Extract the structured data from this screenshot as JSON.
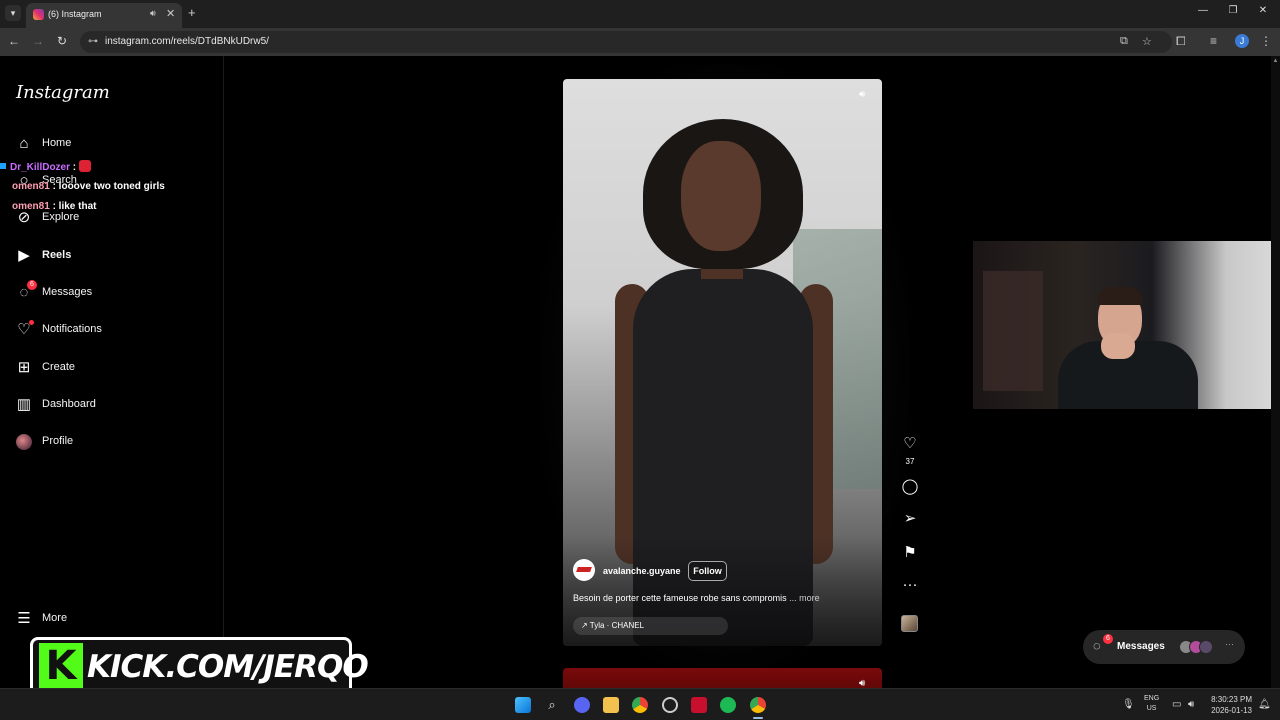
{
  "browser": {
    "tab_title": "(6) Instagram",
    "url": "instagram.com/reels/DTdBNkUDrw5/",
    "icons": {
      "tab_list": "chevron-down-icon",
      "audio": "speaker-icon",
      "close": "close-icon",
      "new_tab": "plus-icon"
    },
    "window_controls": {
      "minimize": "—",
      "restore": "❐",
      "close": "✕"
    }
  },
  "sidebar": {
    "logo": "Instagram",
    "items": [
      {
        "label": "Home",
        "icon": "home-icon"
      },
      {
        "label": "Search",
        "icon": "search-icon"
      },
      {
        "label": "Explore",
        "icon": "compass-icon"
      },
      {
        "label": "Reels",
        "icon": "reels-icon"
      },
      {
        "label": "Messages",
        "icon": "messenger-icon",
        "badge": "6"
      },
      {
        "label": "Notifications",
        "icon": "heart-icon"
      },
      {
        "label": "Create",
        "icon": "plus-square-icon"
      },
      {
        "label": "Dashboard",
        "icon": "chart-icon"
      },
      {
        "label": "Profile",
        "icon": "avatar"
      }
    ],
    "more_label": "More"
  },
  "chat_overlay": [
    {
      "user": "Dr_KillDozer",
      "sep": " :",
      "text": ""
    },
    {
      "user": "omen81",
      "sep": " :",
      "text": " looove two toned girls"
    },
    {
      "user": "omen81",
      "sep": " :",
      "text": " like that"
    }
  ],
  "reel": {
    "author": "avalanche.guyane",
    "follow_label": "Follow",
    "caption": "Besoin de porter cette fameuse robe sans compromis",
    "caption_more": " ... more",
    "audio": "Tyla · CHANEL",
    "like_count": "37"
  },
  "overlay_brand": {
    "kick_letter": "K",
    "kick_text": "KICK.COM/JERQO"
  },
  "messages_pill": {
    "label": "Messages",
    "badge": "6"
  },
  "taskbar": {
    "lang_line1": "ENG",
    "lang_line2": "US",
    "time": "8:30:23 PM",
    "date": "2026-01-13"
  },
  "colors": {
    "accent_red": "#ff3040",
    "kick_green": "#53fc18",
    "chat_user1": "#c86cff",
    "chat_user2": "#ff9fb4"
  }
}
